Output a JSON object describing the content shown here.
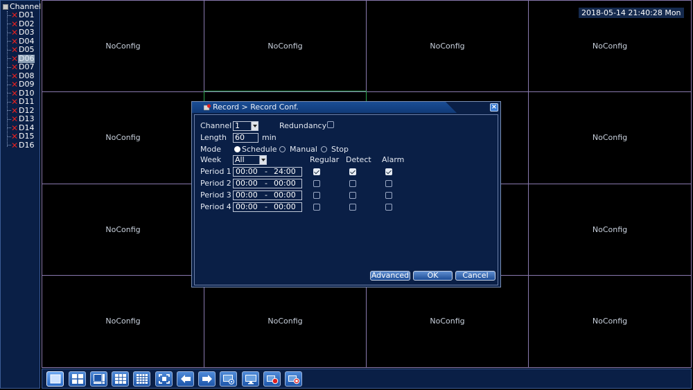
{
  "sidebar": {
    "root_label": "Channel",
    "channels": [
      "D01",
      "D02",
      "D03",
      "D04",
      "D05",
      "D06",
      "D07",
      "D08",
      "D09",
      "D10",
      "D11",
      "D12",
      "D13",
      "D14",
      "D15",
      "D16"
    ],
    "selected": "D06",
    "status_icon": "x-icon"
  },
  "grid": {
    "cell_text": "NoConfig"
  },
  "clock": "2018-05-14 21:40:28 Mon",
  "dialog": {
    "title": "Record > Record Conf.",
    "channel_label": "Channel",
    "channel_value": "1",
    "redundancy_label": "Redundancy",
    "redundancy_checked": false,
    "length_label": "Length",
    "length_value": "60",
    "length_unit": "min",
    "mode_label": "Mode",
    "modes": [
      "Schedule",
      "Manual",
      "Stop"
    ],
    "mode_selected": "Schedule",
    "week_label": "Week",
    "week_value": "All",
    "col_regular": "Regular",
    "col_detect": "Detect",
    "col_alarm": "Alarm",
    "periods": [
      {
        "label": "Period 1",
        "start": "00:00",
        "sep": "-",
        "end": "24:00",
        "regular": true,
        "detect": true,
        "alarm": true
      },
      {
        "label": "Period 2",
        "start": "00:00",
        "sep": "-",
        "end": "00:00",
        "regular": false,
        "detect": false,
        "alarm": false
      },
      {
        "label": "Period 3",
        "start": "00:00",
        "sep": "-",
        "end": "00:00",
        "regular": false,
        "detect": false,
        "alarm": false
      },
      {
        "label": "Period 4",
        "start": "00:00",
        "sep": "-",
        "end": "00:00",
        "regular": false,
        "detect": false,
        "alarm": false
      }
    ],
    "btn_advanced": "Advanced",
    "btn_ok": "OK",
    "btn_cancel": "Cancel"
  },
  "toolbar": {
    "buttons": [
      "single-view-icon",
      "quad-view-icon",
      "eight-view-icon",
      "nine-view-icon",
      "sixteen-view-icon",
      "fullscreen-icon",
      "previous-icon",
      "next-icon",
      "playback-icon",
      "monitor-icon",
      "record-icon",
      "stop-record-icon"
    ],
    "active": "single-view-icon"
  },
  "colors": {
    "panel_bg": "#0a1f46",
    "grid_line": "#8a7ab0",
    "active_cell": "#2fa84f",
    "error_x": "#e02020",
    "button_blue": "#1d56aa"
  }
}
